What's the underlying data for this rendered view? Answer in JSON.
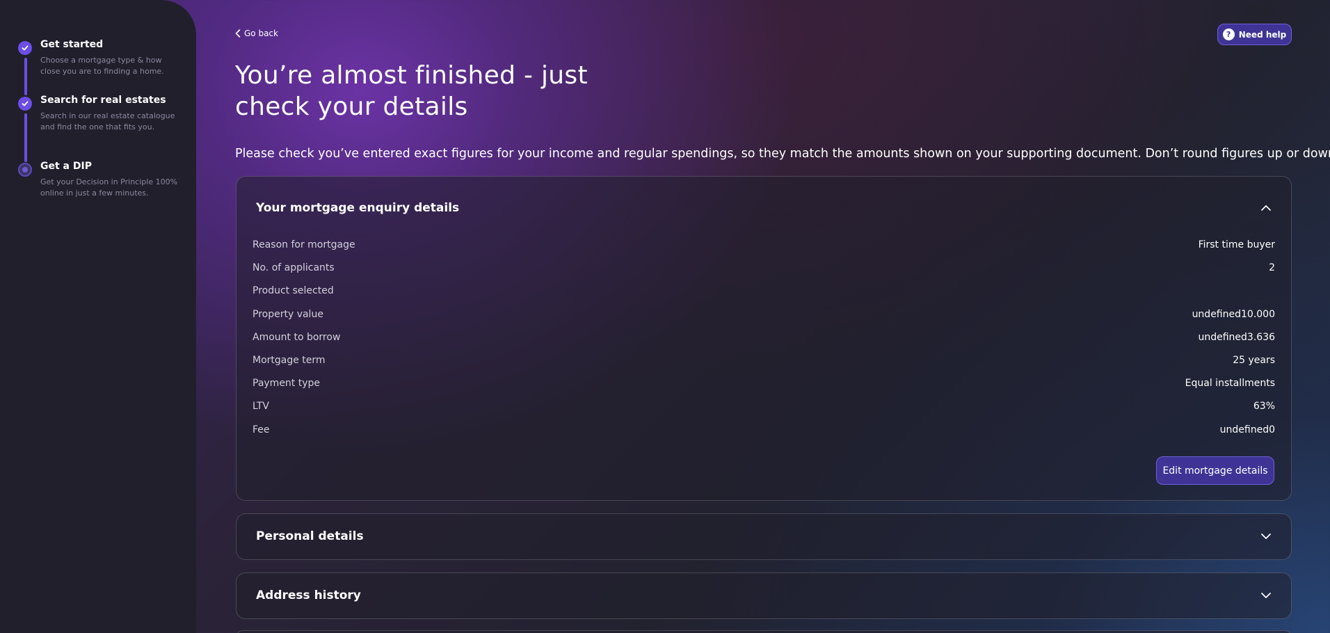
{
  "sidebar": {
    "steps": [
      {
        "title": "Get started",
        "description": "Choose a mortgage type & how close you are to finding a home.",
        "status": "completed"
      },
      {
        "title": "Search for real estates",
        "description": "Search in our real estate catalogue and find the one that fits you.",
        "status": "completed"
      },
      {
        "title": "Get a DIP",
        "description": "Get your Decision in Principle 100% online in just a few minutes.",
        "status": "current"
      }
    ]
  },
  "header": {
    "back_label": "Go back",
    "help_label": "Need help",
    "help_icon_glyph": "?",
    "title": "You’re almost finished - just check your details",
    "intro": "Please check you’ve entered exact figures for your income and regular spendings, so they match the amounts shown on your supporting document. Don’t round figures up or down."
  },
  "mortgage_panel": {
    "title": "Your mortgage enquiry details",
    "rows": [
      {
        "label": "Reason for mortgage",
        "value": "First time buyer"
      },
      {
        "label": "No. of applicants",
        "value": "2"
      },
      {
        "label": "Product selected",
        "value": ""
      },
      {
        "label": "Property value",
        "value": "undefined10.000"
      },
      {
        "label": "Amount to borrow",
        "value": "undefined3.636"
      },
      {
        "label": "Mortgage term",
        "value": "25 years"
      },
      {
        "label": "Payment type",
        "value": "Equal installments"
      },
      {
        "label": "LTV",
        "value": "63%"
      },
      {
        "label": "Fee",
        "value": "undefined0"
      }
    ],
    "edit_label": "Edit mortgage details"
  },
  "personal_panel": {
    "title": "Personal details"
  },
  "address_panel": {
    "title": "Address history"
  },
  "colors": {
    "accent": "#6c4ee6",
    "button_bg": "#3f3496",
    "sidebar_bg": "#211f2c"
  }
}
